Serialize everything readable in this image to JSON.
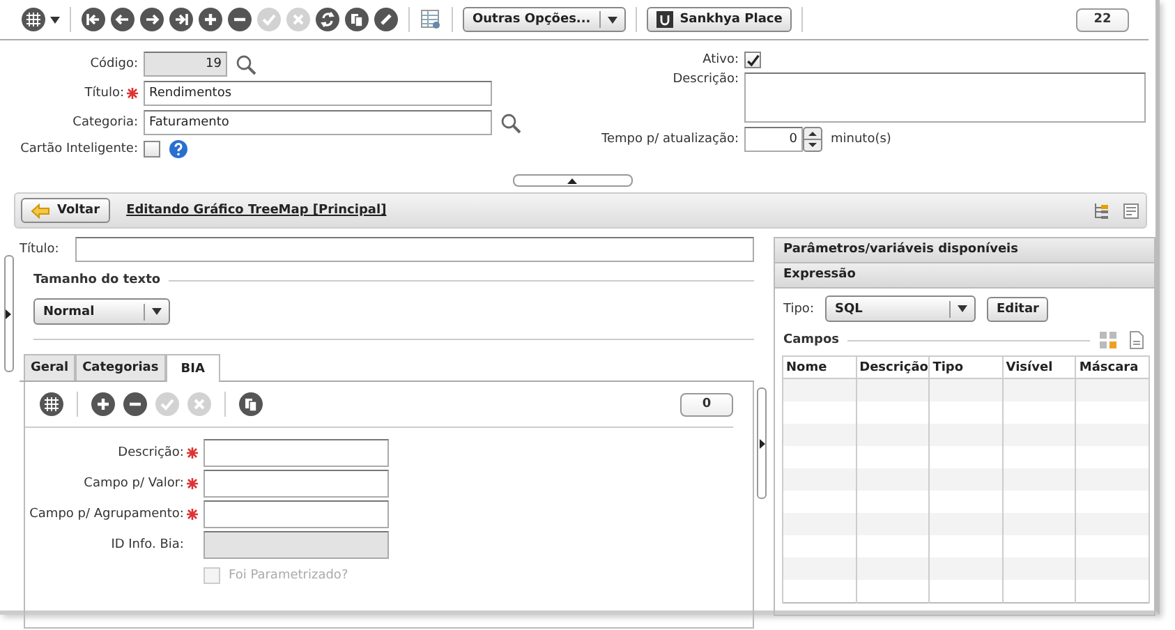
{
  "toolbar": {
    "buttons": [
      {
        "disabled": false
      },
      {
        "disabled": false
      },
      {
        "disabled": false
      },
      {
        "disabled": false
      },
      {
        "disabled": false
      },
      {
        "disabled": false
      },
      {
        "disabled": true
      },
      {
        "disabled": true
      },
      {
        "disabled": false
      },
      {
        "disabled": false
      },
      {
        "disabled": false
      }
    ],
    "more_options": "Outras Opções...",
    "place_button": "Sankhya Place",
    "count": "22"
  },
  "form": {
    "codigo": {
      "label": "Código:",
      "value": "19"
    },
    "titulo": {
      "label": "Título:",
      "value": "Rendimentos",
      "required": true
    },
    "categoria": {
      "label": "Categoria:",
      "value": "Faturamento"
    },
    "cartao": {
      "label": "Cartão Inteligente:",
      "checked": false
    },
    "ativo": {
      "label": "Ativo:",
      "checked": true
    },
    "descricao": {
      "label": "Descrição:"
    },
    "tempo": {
      "label": "Tempo p/ atualização:",
      "value": "0",
      "unit": "minuto(s)"
    }
  },
  "editor_header": {
    "back_button": "Voltar",
    "title": "Editando Gráfico TreeMap [Principal]"
  },
  "chart_settings": {
    "title_label": "Título:",
    "text_size": {
      "legend": "Tamanho do texto",
      "value": "Normal"
    },
    "tabs": [
      {
        "label": "Geral",
        "selected": false
      },
      {
        "label": "Categorias",
        "selected": false
      },
      {
        "label": "BIA",
        "selected": true
      }
    ],
    "bia": {
      "buttons": [
        {
          "disabled": false
        },
        {
          "disabled": false
        },
        {
          "disabled": true
        },
        {
          "disabled": true
        },
        {
          "disabled": false
        }
      ],
      "count": "0",
      "fields": [
        {
          "label": "Descrição:",
          "required": true,
          "disabled": false
        },
        {
          "label": "Campo p/ Valor:",
          "required": true,
          "disabled": false
        },
        {
          "label": "Campo p/ Agrupamento:",
          "required": true,
          "disabled": false
        },
        {
          "label": "ID Info. Bia:",
          "required": false,
          "disabled": true
        }
      ],
      "checkbox": {
        "label": "Foi Parametrizado?",
        "checked": false,
        "disabled": true
      }
    }
  },
  "right_panel": {
    "sections": [
      "Parâmetros/variáveis disponíveis",
      "Expressão"
    ],
    "tipo": {
      "label": "Tipo:",
      "value": "SQL"
    },
    "edit_button": "Editar",
    "campos_legend": "Campos",
    "table": {
      "columns": [
        "Nome",
        "Descrição",
        "Tipo",
        "Visível",
        "Máscara"
      ]
    }
  }
}
